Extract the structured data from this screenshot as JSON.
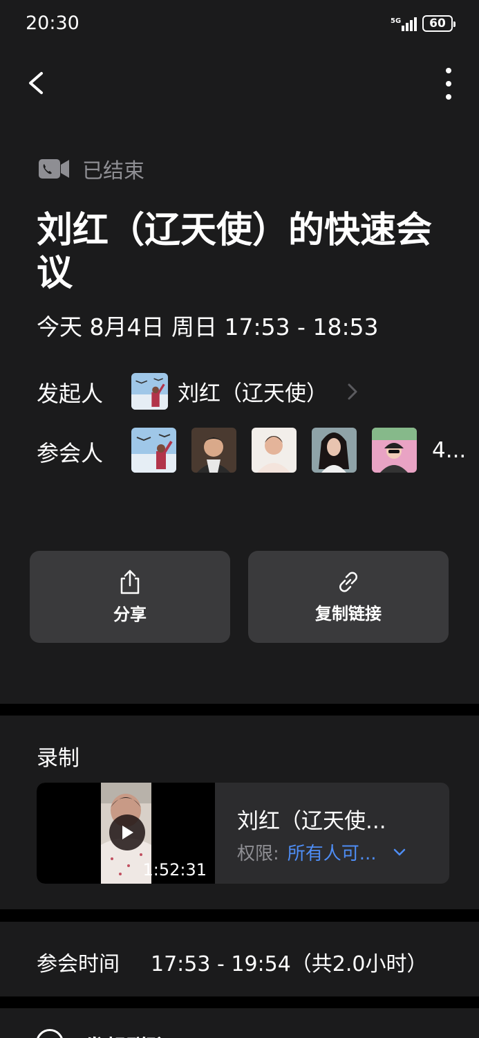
{
  "status_bar": {
    "time": "20:30",
    "network": "5G",
    "battery": "60"
  },
  "meeting": {
    "status": "已结束",
    "title": "刘红（辽天使）的快速会议",
    "time_range": "今天 8月4日 周日 17:53 - 18:53"
  },
  "host": {
    "label": "发起人",
    "name": "刘红（辽天使）"
  },
  "participants": {
    "label": "参会人",
    "more": "4..."
  },
  "actions": {
    "share": "分享",
    "copy_link": "复制链接"
  },
  "recording": {
    "section_title": "录制",
    "duration": "1:52:31",
    "name": "刘红（辽天使...",
    "permission_label": "权限:",
    "permission_value": "所有人可..."
  },
  "attendance": {
    "label": "参会时间",
    "value": "17:53 - 19:54（共2.0小时）"
  },
  "bottom": {
    "label": "发起群聊"
  },
  "icons": [
    "back-icon",
    "more-icon",
    "video-call-icon",
    "share-icon",
    "link-icon",
    "play-icon",
    "chevron-right-icon",
    "chevron-down-icon"
  ],
  "colors": {
    "background": "#1b1b1c",
    "button": "#3a3a3c",
    "card": "#2c2c2e",
    "accent": "#4e8df5",
    "muted": "#8e8e93"
  }
}
